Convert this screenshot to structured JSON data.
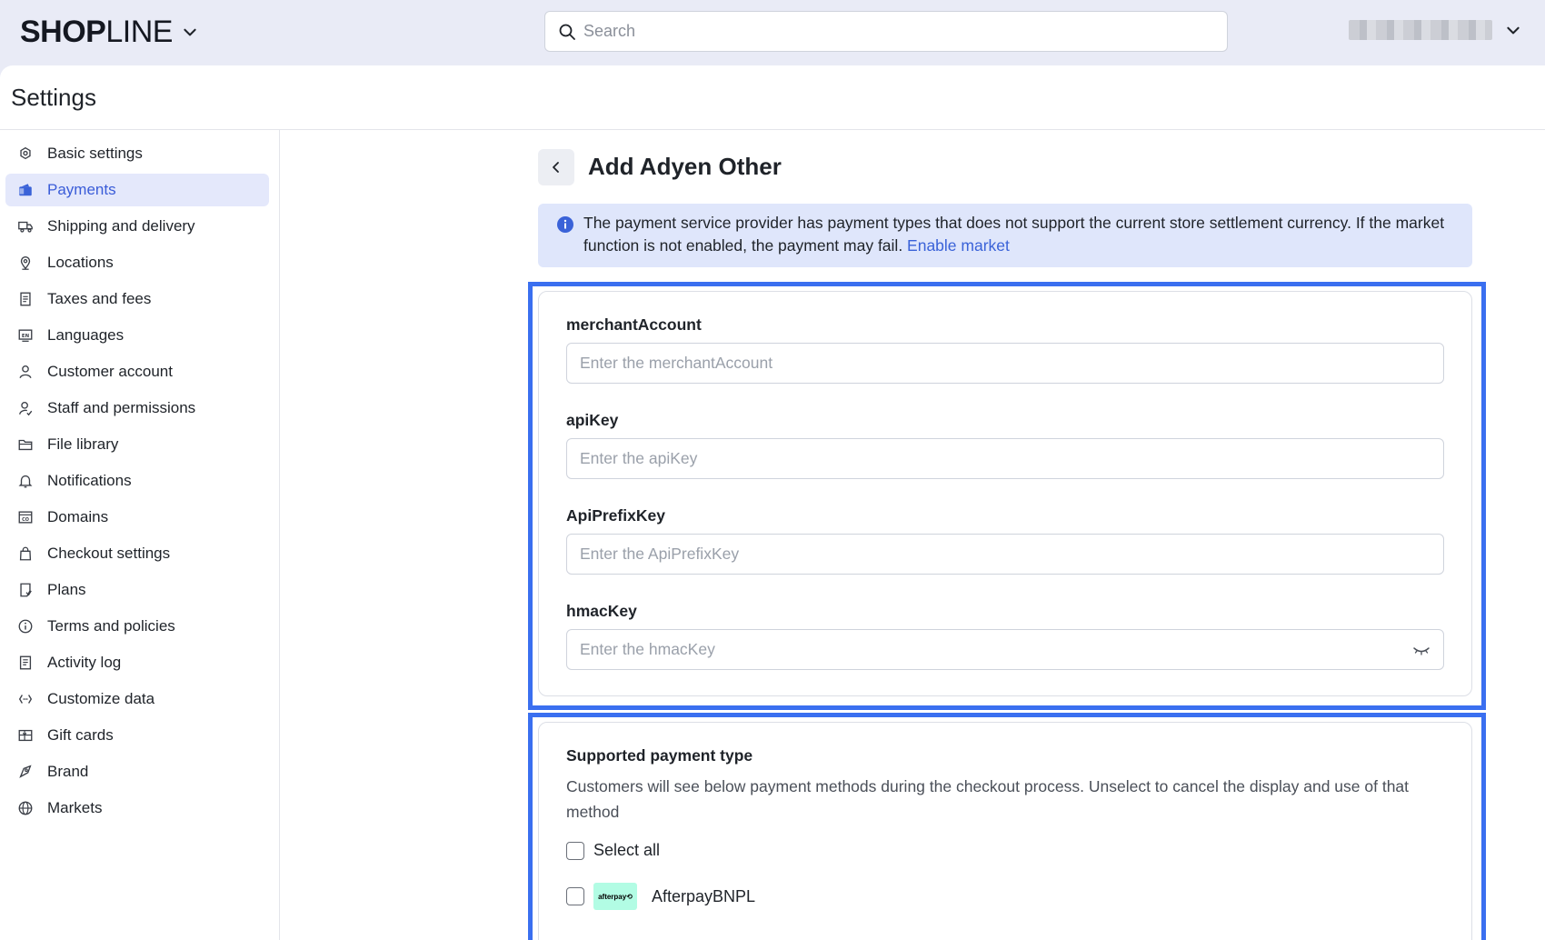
{
  "topbar": {
    "logo_bold": "SHOP",
    "logo_thin": "LINE",
    "search_placeholder": "Search"
  },
  "page": {
    "title": "Settings"
  },
  "sidebar": {
    "items": [
      {
        "label": "Basic settings",
        "icon": "gear-icon",
        "active": false
      },
      {
        "label": "Payments",
        "icon": "wallet-icon",
        "active": true
      },
      {
        "label": "Shipping and delivery",
        "icon": "truck-icon",
        "active": false
      },
      {
        "label": "Locations",
        "icon": "location-pin-icon",
        "active": false
      },
      {
        "label": "Taxes and fees",
        "icon": "receipt-icon",
        "active": false
      },
      {
        "label": "Languages",
        "icon": "language-icon",
        "active": false
      },
      {
        "label": "Customer account",
        "icon": "person-icon",
        "active": false
      },
      {
        "label": "Staff and permissions",
        "icon": "staff-icon",
        "active": false
      },
      {
        "label": "File library",
        "icon": "folder-icon",
        "active": false
      },
      {
        "label": "Notifications",
        "icon": "bell-icon",
        "active": false
      },
      {
        "label": "Domains",
        "icon": "domain-icon",
        "active": false
      },
      {
        "label": "Checkout settings",
        "icon": "bag-icon",
        "active": false
      },
      {
        "label": "Plans",
        "icon": "plan-icon",
        "active": false
      },
      {
        "label": "Terms and policies",
        "icon": "info-icon",
        "active": false
      },
      {
        "label": "Activity log",
        "icon": "log-icon",
        "active": false
      },
      {
        "label": "Customize data",
        "icon": "code-icon",
        "active": false
      },
      {
        "label": "Gift cards",
        "icon": "gift-card-icon",
        "active": false
      },
      {
        "label": "Brand",
        "icon": "brand-icon",
        "active": false
      },
      {
        "label": "Markets",
        "icon": "globe-icon",
        "active": false
      }
    ]
  },
  "main": {
    "title": "Add Adyen Other",
    "alert": {
      "text": "The payment service provider has payment types that does not support the current store settlement currency. If the market function is not enabled, the payment may fail. ",
      "link": "Enable market"
    },
    "fields": [
      {
        "label": "merchantAccount",
        "placeholder": "Enter the merchantAccount",
        "value": ""
      },
      {
        "label": "apiKey",
        "placeholder": "Enter the apiKey",
        "value": ""
      },
      {
        "label": "ApiPrefixKey",
        "placeholder": "Enter the ApiPrefixKey",
        "value": ""
      },
      {
        "label": "hmacKey",
        "placeholder": "Enter the hmacKey",
        "value": ""
      }
    ],
    "payment_types": {
      "title": "Supported payment type",
      "description": "Customers will see below payment methods during the checkout process. Unselect to cancel the display and use of that method",
      "select_all": "Select all",
      "methods": [
        {
          "label": "AfterpayBNPL",
          "logo_text": "afterpay⟲",
          "checked": false
        }
      ]
    }
  },
  "colors": {
    "accent": "#3a62d8",
    "active_bg": "#e4e8fb",
    "alert_bg": "#dfe6fb",
    "focus_outline": "#3a6ff0"
  }
}
